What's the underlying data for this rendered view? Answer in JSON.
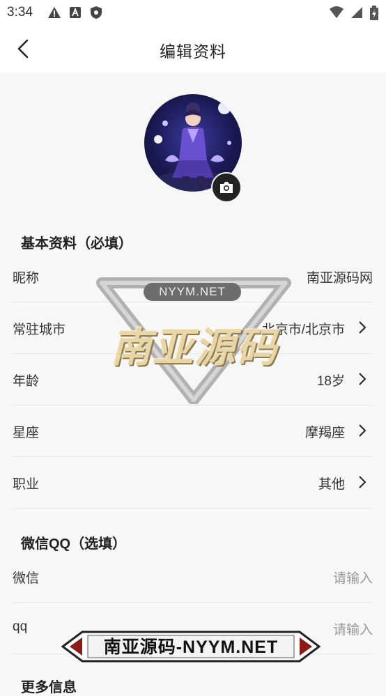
{
  "status_bar": {
    "time": "3:34"
  },
  "header": {
    "title": "编辑资料"
  },
  "basic_section": {
    "title": "基本资料（必填）",
    "rows": [
      {
        "label": "昵称",
        "value": "南亚源码网"
      },
      {
        "label": "常驻城市",
        "value": "北京市/北京市"
      },
      {
        "label": "年龄",
        "value": "18岁"
      },
      {
        "label": "星座",
        "value": "摩羯座"
      },
      {
        "label": "职业",
        "value": "其他"
      }
    ]
  },
  "contact_section": {
    "title": "微信QQ（选填）",
    "rows": [
      {
        "label": "微信",
        "placeholder": "请输入"
      },
      {
        "label": "qq",
        "placeholder": "请输入"
      }
    ]
  },
  "more_section": {
    "title": "更多信息"
  },
  "watermark": {
    "badge": "NYYM.NET",
    "big": "南亚源码",
    "bottom": "南亚源码-NYYM.NET"
  }
}
